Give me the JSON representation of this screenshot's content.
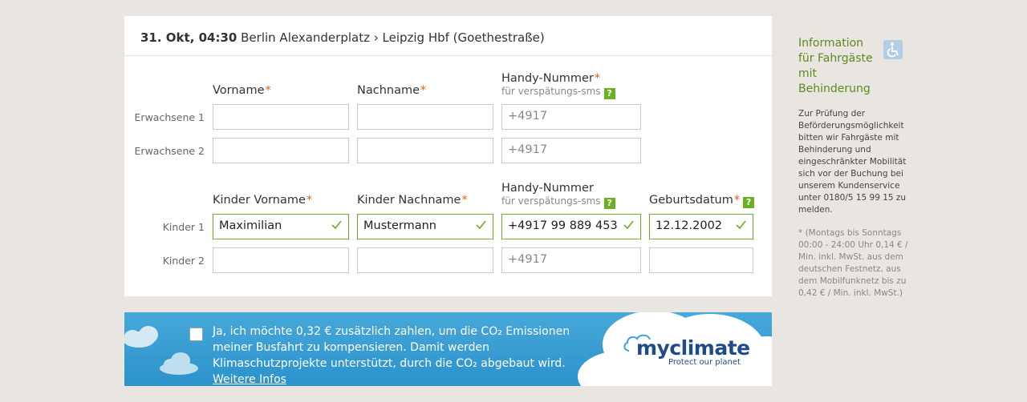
{
  "trip": {
    "date": "31. Okt, 04:30",
    "route": "Berlin Alexanderplatz › Leipzig Hbf (Goethestraße)"
  },
  "adults": {
    "first_name_label": "Vorname",
    "last_name_label": "Nachname",
    "phone_label": "Handy-Nummer",
    "phone_sub": "für verspätungs-sms",
    "rows": [
      {
        "label": "Erwachsene 1",
        "first": "",
        "last": "",
        "phone": "+4917"
      },
      {
        "label": "Erwachsene 2",
        "first": "",
        "last": "",
        "phone": "+4917"
      }
    ]
  },
  "children": {
    "first_name_label": "Kinder Vorname",
    "last_name_label": "Kinder Nachname",
    "phone_label": "Handy-Nummer",
    "phone_sub": "für verspätungs-sms",
    "birth_label": "Geburtsdatum",
    "rows": [
      {
        "label": "Kinder 1",
        "first": "Maximilian",
        "last": "Mustermann",
        "phone": "+4917 99 889 453",
        "birth": "12.12.2002"
      },
      {
        "label": "Kinder 2",
        "first": "",
        "last": "",
        "phone": "+4917",
        "birth": ""
      }
    ]
  },
  "required_mark": "*",
  "help_mark": "?",
  "banner": {
    "text_main": "Ja, ich möchte 0,32 € zusätzlich zahlen, um die CO₂ Emissionen meiner Busfahrt zu kompensieren. Damit werden Klimaschutzprojekte unterstützt, durch die CO₂ abgebaut wird.",
    "link": "Weitere Infos",
    "logo": "myclimate",
    "logo_tagline": "Protect our planet",
    "checked": false
  },
  "sidebar": {
    "title": "Information für Fahrgäste mit Behinderung",
    "icon": "wheelchair-icon",
    "body": "Zur Prüfung der Beförderungsmöglichkeit bitten wir Fahrgäste mit Behinderung und eingeschränkter Mobilität sich vor der Buchung bei unserem Kundenservice unter 0180/5 15 99 15 zu melden.",
    "note": "* (Montags bis Sonntags 00:00 - 24:00 Uhr 0,14 € / Min. inkl. MwSt. aus dem deutschen Festnetz, aus dem Mobilfunknetz bis zu 0,42 € / Min. inkl. MwSt.)"
  },
  "colors": {
    "accent_green": "#6ab023",
    "required_orange": "#e8610c",
    "sidebar_title": "#5e8a1e",
    "banner_blue": "#2b92cc",
    "logo_blue": "#1e4b8c"
  }
}
